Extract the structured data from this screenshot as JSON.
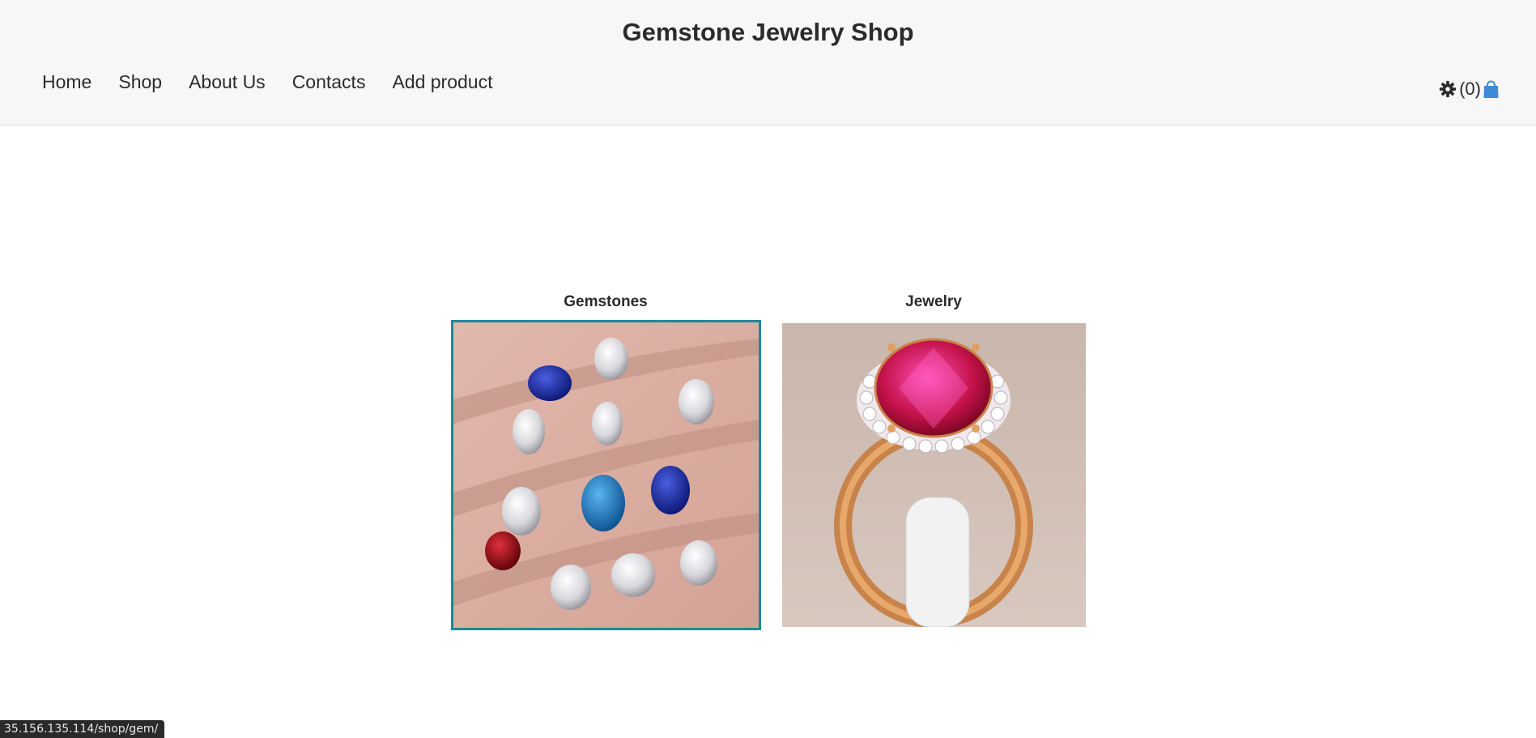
{
  "header": {
    "title": "Gemstone Jewelry Shop",
    "nav": [
      {
        "label": "Home"
      },
      {
        "label": "Shop"
      },
      {
        "label": "About Us"
      },
      {
        "label": "Contacts"
      },
      {
        "label": "Add product"
      }
    ],
    "cart_count": "(0)"
  },
  "categories": [
    {
      "label": "Gemstones"
    },
    {
      "label": "Jewelry"
    }
  ],
  "status_bar": {
    "url": "35.156.135.114/shop/gem/"
  },
  "colors": {
    "header_bg": "#f7f7f7",
    "selected_border": "#1e8a96",
    "cart_bag": "#3d8bd8"
  }
}
